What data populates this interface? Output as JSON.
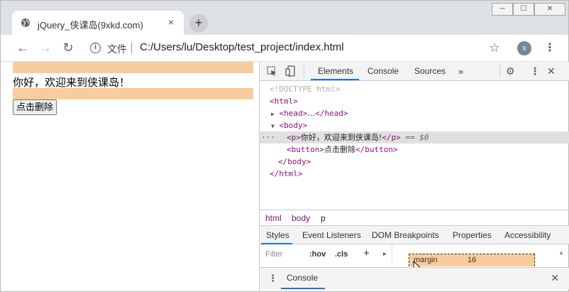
{
  "window": {
    "minimize": "─",
    "maximize": "☐",
    "close": "✕"
  },
  "tab": {
    "title": "jQuery_侠课岛(9xkd.com)",
    "close": "×"
  },
  "toolbar": {
    "back": "←",
    "forward": "→",
    "reload": "↻",
    "info": "i",
    "file_label": "文件",
    "url": "C:/Users/lu/Desktop/test_project/index.html",
    "star": "☆",
    "avatar_letter": "x",
    "menu": "⋮"
  },
  "page": {
    "greeting": "你好，欢迎来到侠课岛！",
    "button_label": "点击删除"
  },
  "devtools": {
    "tabs": [
      "Elements",
      "Console",
      "Sources"
    ],
    "more": "»",
    "dom": {
      "doctype": "<!DOCTYPE html>",
      "html_open": "<html>",
      "head_open": "<head>",
      "head_ellipsis": "…",
      "head_close": "</head>",
      "body_open": "<body>",
      "p_open": "<p>",
      "p_text": "你好，欢迎来到侠课岛!",
      "p_close": "</p>",
      "p_eq": " == $0",
      "button_open": "<button>",
      "button_text": "点击删除",
      "button_close": "</button>",
      "body_close": "</body>",
      "html_close": "</html>",
      "dots": "···"
    },
    "breadcrumbs": [
      "html",
      "body",
      "p"
    ],
    "subtabs": [
      "Styles",
      "Event Listeners",
      "DOM Breakpoints",
      "Properties",
      "Accessibility"
    ],
    "filter_placeholder": "Filter",
    "hov": ":hov",
    "cls": ".cls",
    "plus": "+",
    "box_margin_label": "margin",
    "box_margin_value": "16",
    "drawer_label": "Console",
    "close": "✕"
  },
  "colors": {
    "accent": "#1a73e8",
    "highlight": "#f9cc9d",
    "tag": "#881280"
  }
}
